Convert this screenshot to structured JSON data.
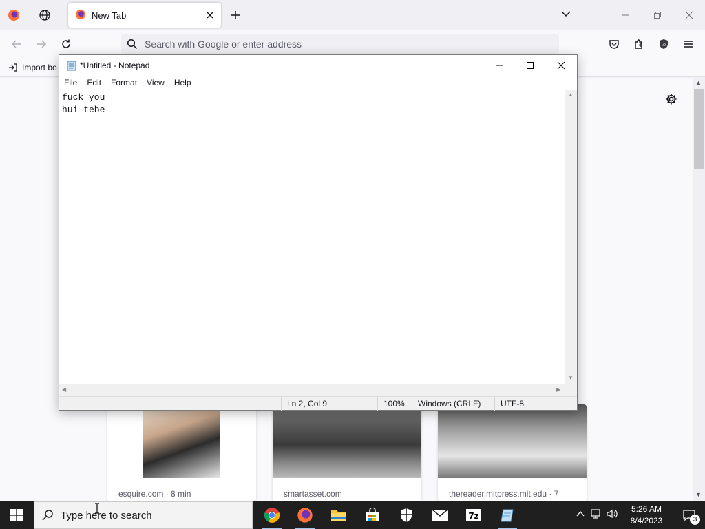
{
  "firefox": {
    "tab_title": "New Tab",
    "url_placeholder": "Search with Google or enter address",
    "bookmark_import": "Import bo",
    "cards": [
      {
        "source": "esquire.com · 8 min"
      },
      {
        "source": "smartasset.com"
      },
      {
        "source": "thereader.mitpress.mit.edu · 7"
      }
    ]
  },
  "notepad": {
    "title": "*Untitled - Notepad",
    "menu": [
      "File",
      "Edit",
      "Format",
      "View",
      "Help"
    ],
    "text_lines": [
      "fuck you",
      "hui tebe"
    ],
    "status": {
      "position": "Ln 2, Col 9",
      "zoom": "100%",
      "line_ending": "Windows (CRLF)",
      "encoding": "UTF-8"
    }
  },
  "taskbar": {
    "search_placeholder": "Type here to search",
    "time": "5:26 AM",
    "date": "8/4/2023",
    "notification_count": "3",
    "accent_color": "#9fc3e8"
  }
}
